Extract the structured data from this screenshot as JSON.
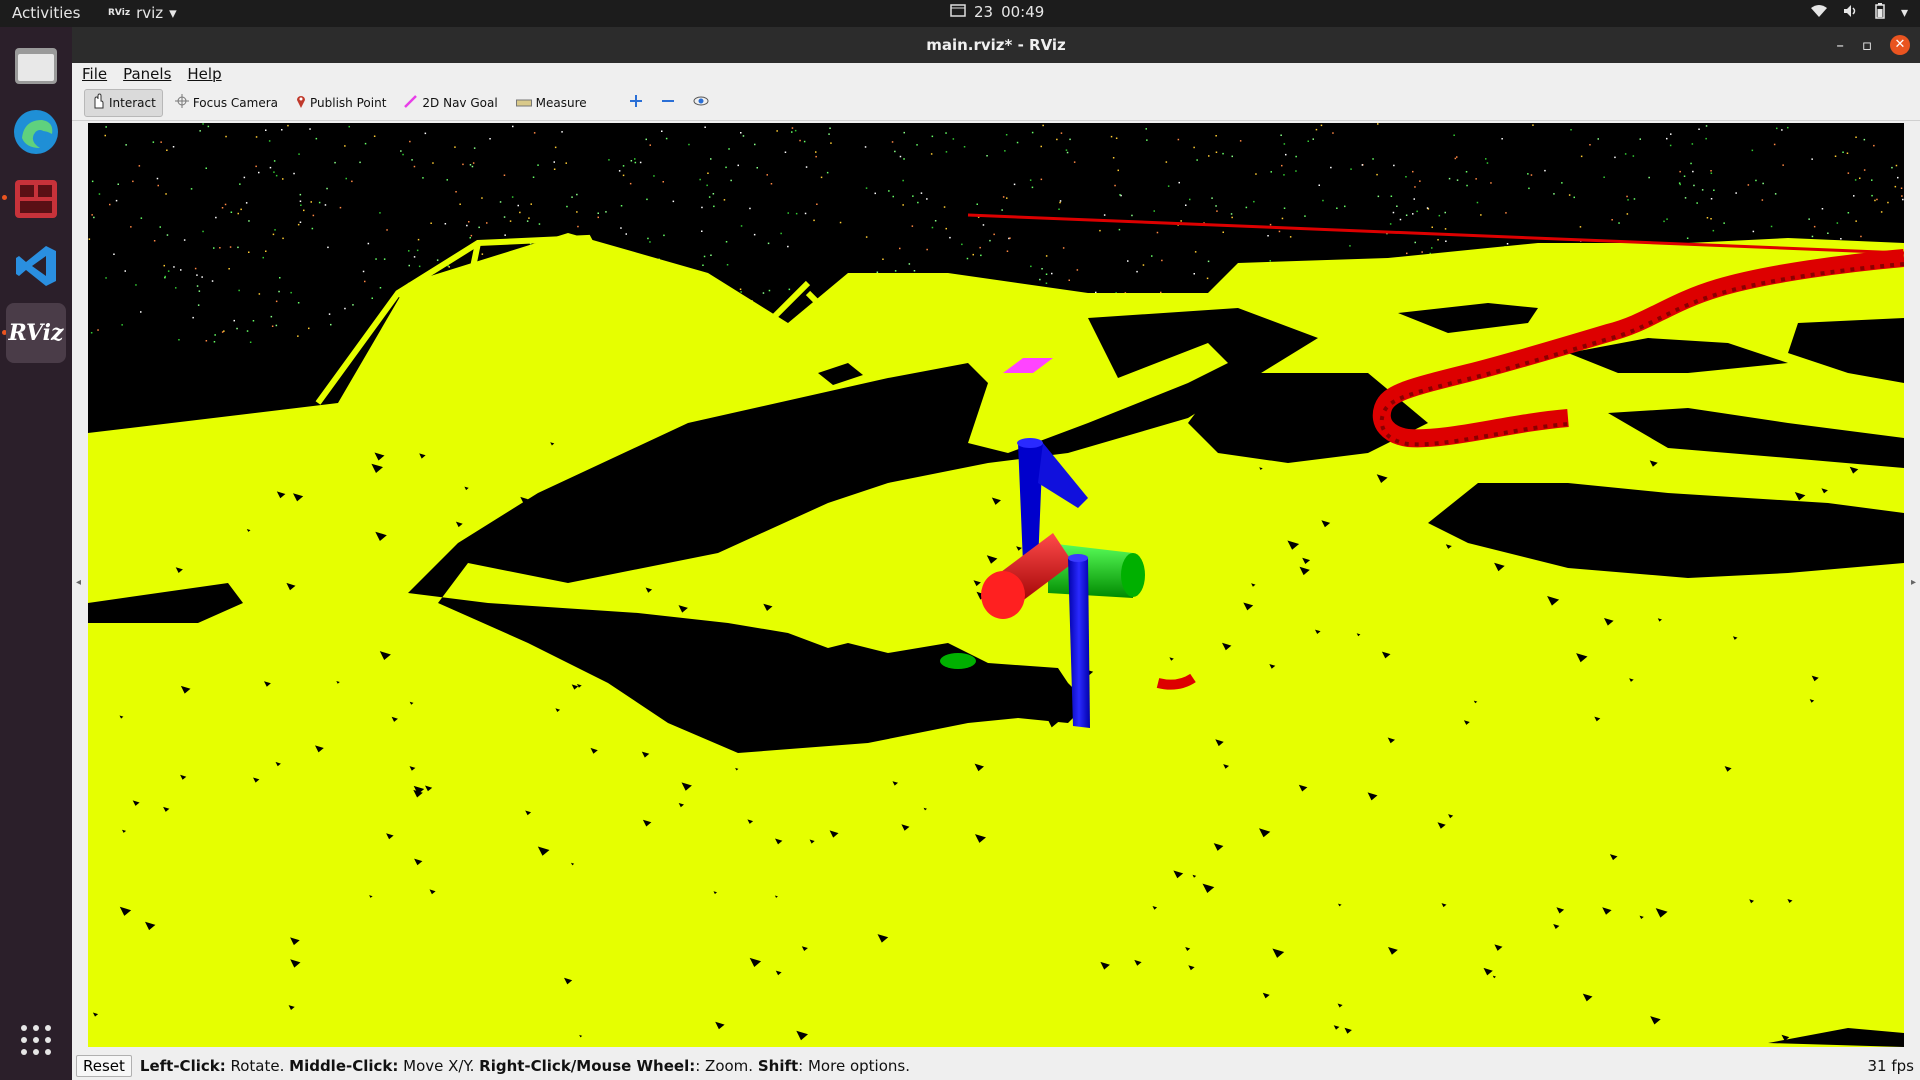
{
  "topbar": {
    "activities": "Activities",
    "app_name": "rviz",
    "app_badge": "RViz",
    "date": "23",
    "time": "00:49"
  },
  "dock": {
    "items": [
      "files-icon",
      "edge-browser-icon",
      "terminal-app-icon",
      "vscode-icon",
      "rviz-icon"
    ],
    "rviz_label": "RViz"
  },
  "window": {
    "title": "main.rviz* - RViz",
    "controls": {
      "minimize": "–",
      "maximize": "▫",
      "close": "✕"
    }
  },
  "menubar": {
    "file": "File",
    "panels": "Panels",
    "help": "Help"
  },
  "toolbar": {
    "interact": "Interact",
    "focus_camera": "Focus Camera",
    "publish_point": "Publish Point",
    "nav_goal": "2D Nav Goal",
    "measure": "Measure",
    "selected_tool": "Interact"
  },
  "statusbar": {
    "reset": "Reset",
    "left_click_label": "Left-Click:",
    "left_click_text": " Rotate. ",
    "middle_click_label": "Middle-Click:",
    "middle_click_text": " Move X/Y. ",
    "right_click_label": "Right-Click/Mouse Wheel:",
    "right_click_text": ": Zoom. ",
    "shift_label": "Shift",
    "shift_text": ": More options.",
    "fps": "31 fps"
  },
  "colors": {
    "terrain": "#e6ff00",
    "background": "#000000",
    "path": "#dd0000",
    "axis_x": "#dd0000",
    "axis_y": "#00dd00",
    "axis_z": "#0000ee",
    "goal_marker": "#ff44ff"
  }
}
